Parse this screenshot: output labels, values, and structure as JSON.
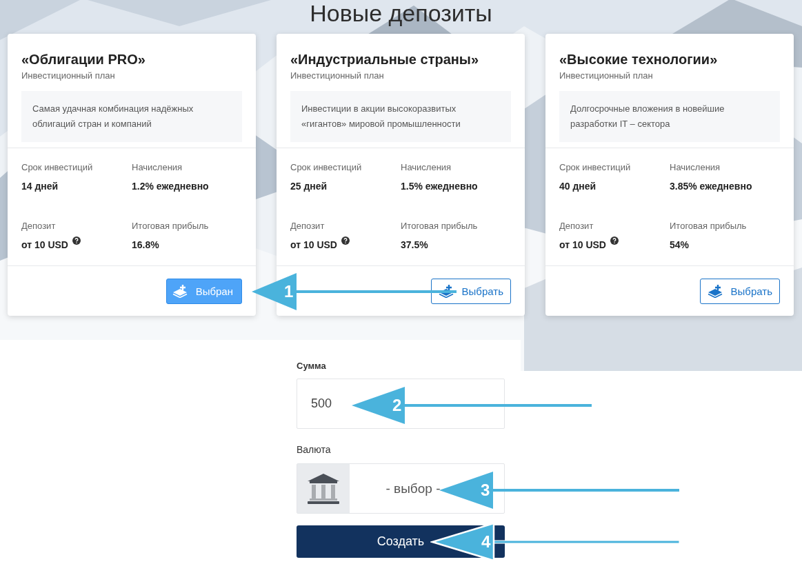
{
  "title": "Новые депозиты",
  "plans": [
    {
      "name": "«Облигации PRO»",
      "subtitle": "Инвестиционный план",
      "description": "Самая удачная комбинация надёжных облигаций стран и компаний",
      "stats": [
        {
          "label": "Срок инвестиций",
          "value": "14 дней",
          "help": false
        },
        {
          "label": "Начисления",
          "value": "1.2% ежедневно",
          "help": false
        },
        {
          "label": "Депозит",
          "value": "от 10 USD",
          "help": true
        },
        {
          "label": "Итоговая прибыль",
          "value": "16.8%",
          "help": false
        }
      ],
      "button": "Выбран",
      "selected": true
    },
    {
      "name": "«Индустриальные страны»",
      "subtitle": "Инвестиционный план",
      "description": "Инвестиции в акции высокоразвитых «гигантов» мировой промышленности",
      "stats": [
        {
          "label": "Срок инвестиций",
          "value": "25 дней",
          "help": false
        },
        {
          "label": "Начисления",
          "value": "1.5% ежедневно",
          "help": false
        },
        {
          "label": "Депозит",
          "value": "от 10 USD",
          "help": true
        },
        {
          "label": "Итоговая прибыль",
          "value": "37.5%",
          "help": false
        }
      ],
      "button": "Выбрать",
      "selected": false
    },
    {
      "name": "«Высокие технологии»",
      "subtitle": "Инвестиционный план",
      "description": "Долгосрочные вложения в новейшие разработки IT – сектора",
      "stats": [
        {
          "label": "Срок инвестиций",
          "value": "40 дней",
          "help": false
        },
        {
          "label": "Начисления",
          "value": "3.85% ежедневно",
          "help": false
        },
        {
          "label": "Депозит",
          "value": "от 10 USD",
          "help": true
        },
        {
          "label": "Итоговая прибыль",
          "value": "54%",
          "help": false
        }
      ],
      "button": "Выбрать",
      "selected": false
    }
  ],
  "form": {
    "amount_label": "Сумма",
    "amount_value": "500",
    "currency_label": "Валюта",
    "currency_value": "- выбор -",
    "submit": "Создать"
  },
  "callouts": [
    {
      "number": "1"
    },
    {
      "number": "2"
    },
    {
      "number": "3"
    },
    {
      "number": "4"
    }
  ]
}
